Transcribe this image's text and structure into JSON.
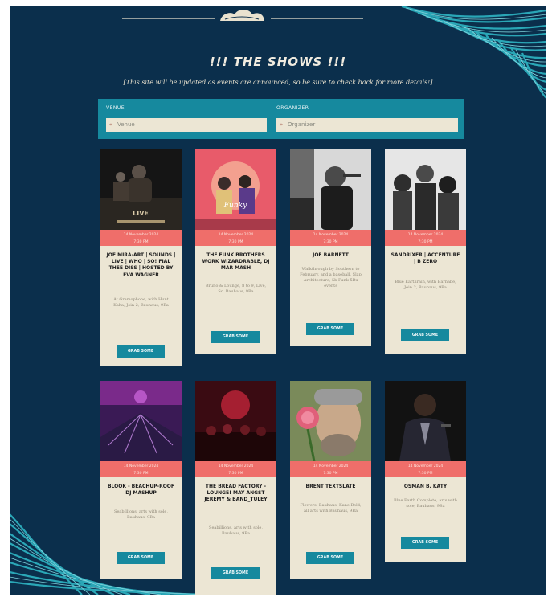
{
  "header": {
    "title": "!!! THE SHOWS !!!",
    "subtitle": "[This site will be updated as events are announced, so be sure to check back for more details!]"
  },
  "filters": {
    "venue_label": "VENUE",
    "venue_placeholder": "Venue",
    "organizer_label": "ORGANIZER",
    "organizer_placeholder": "Organizer"
  },
  "colors": {
    "background": "#0b2f4c",
    "filter_bar": "#16899e",
    "card": "#ece6d4",
    "date_band": "#ef6e6a",
    "button": "#16899e"
  },
  "events": [
    {
      "date": "14 November 2024",
      "time": "7:30 PM",
      "name": "JOE MIRA-ART | SOUNDS | LIVE | WHO | SO! FIAL THEE DISS | HOSTED BY EVA WAGNER",
      "desc": "At Gramophone, with Hunt Kaha, Join 2, Bauhaus, 9Ba",
      "button": "GRAB SOME"
    },
    {
      "date": "14 November 2024",
      "time": "7:30 PM",
      "name": "THE FUNK BROTHERS WORK WIZARDRABLE, DJ MAR MASH",
      "desc": "Bruno & Lounge, 8 to 9, Live, Sc. Bauhaus, 9Ba",
      "button": "GRAB SOME"
    },
    {
      "date": "14 November 2024",
      "time": "7:30 PM",
      "name": "JOE BARNETT",
      "desc": "Walkthrough by Southern to February, and a baseball, Slap Architecture, 5b Funk 5Bx events",
      "button": "GRAB SOME"
    },
    {
      "date": "14 November 2024",
      "time": "7:30 PM",
      "name": "SANDRIXER | ACCENTURE | B ZERO",
      "desc": "Blue Earthrain, with Barnabe, Join 2, Bauhaus, 9Ba",
      "button": "GRAB SOME"
    },
    {
      "date": "14 November 2024",
      "time": "7:30 PM",
      "name": "BLOOK - BEACHUP-ROOF DJ MASHUP",
      "desc": "Seabillions, arts with sole, Bauhaus, 9Ba",
      "button": "GRAB SOME"
    },
    {
      "date": "14 November 2024",
      "time": "7:30 PM",
      "name": "THE BREAD FACTORY - LOUNGE! MAY ANGST JEREMY & BAND_TULEY",
      "desc": "Seabillions, arts with sole, Bauhaus, 9Ba",
      "button": "GRAB SOME"
    },
    {
      "date": "14 November 2024",
      "time": "7:30 PM",
      "name": "BRENT TEXTSLATE",
      "desc": "Flowers, Bauhaus, Kane Bold, all arts with Bauhaus, 9Ba",
      "button": "GRAB SOME"
    },
    {
      "date": "14 November 2024",
      "time": "7:30 PM",
      "name": "OSMAN B. KATY",
      "desc": "Blue Earth Complete, arts with sole, Bauhaus, 9Ba",
      "button": "GRAB SOME"
    }
  ]
}
